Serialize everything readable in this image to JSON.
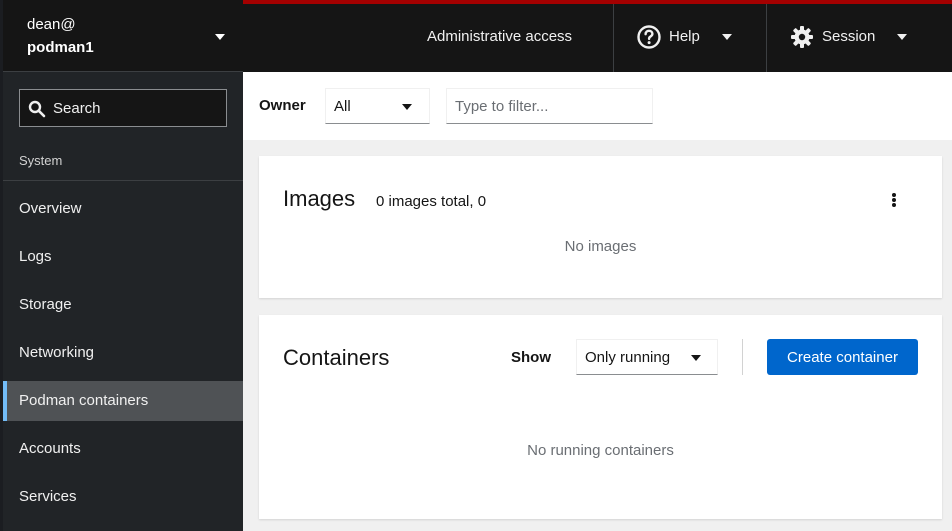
{
  "host": {
    "user": "dean@",
    "name": "podman1"
  },
  "sidebar": {
    "search_label": "Search",
    "group_label": "System",
    "items": [
      {
        "label": "Overview"
      },
      {
        "label": "Logs"
      },
      {
        "label": "Storage"
      },
      {
        "label": "Networking"
      },
      {
        "label": "Podman containers",
        "active": true
      },
      {
        "label": "Accounts"
      },
      {
        "label": "Services"
      }
    ]
  },
  "masthead": {
    "admin_access": "Administrative access",
    "help": {
      "label": "Help",
      "icon": "help-circle-icon"
    },
    "session": {
      "label": "Session",
      "icon": "gear-icon"
    },
    "accent_color": "#a30000"
  },
  "filter": {
    "owner_label": "Owner",
    "owner_value": "All",
    "text_placeholder": "Type to filter..."
  },
  "images": {
    "title": "Images",
    "count": "0 images total, 0",
    "empty": "No images"
  },
  "containers": {
    "title": "Containers",
    "show_label": "Show",
    "show_value": "Only running",
    "create_button": "Create container",
    "empty": "No running containers"
  },
  "colors": {
    "primary": "#0066cc",
    "nav_active_indicator": "#73bcf7",
    "sidebar_bg": "#212427"
  }
}
